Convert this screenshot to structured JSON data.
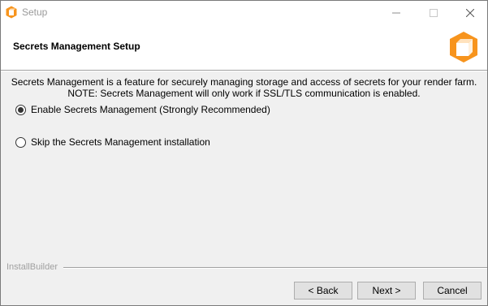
{
  "window": {
    "title": "Setup"
  },
  "header": {
    "page_title": "Secrets Management Setup"
  },
  "body": {
    "description_line1": "Secrets Management is a feature for securely managing storage and access of secrets for your render farm.",
    "description_line2": "NOTE: Secrets Management will only work if SSL/TLS communication is enabled.",
    "options": [
      {
        "label": "Enable Secrets Management (Strongly Recommended)",
        "selected": true
      },
      {
        "label": "Skip the Secrets Management installation",
        "selected": false
      }
    ]
  },
  "footer": {
    "brand": "InstallBuilder",
    "back_label": "< Back",
    "next_label": "Next >",
    "cancel_label": "Cancel"
  },
  "colors": {
    "accent": "#f7941d",
    "background": "#f0f0f0"
  },
  "icons": {
    "app": "orange-cube-icon",
    "minimize": "minimize-icon",
    "maximize": "maximize-icon",
    "close": "close-icon"
  }
}
